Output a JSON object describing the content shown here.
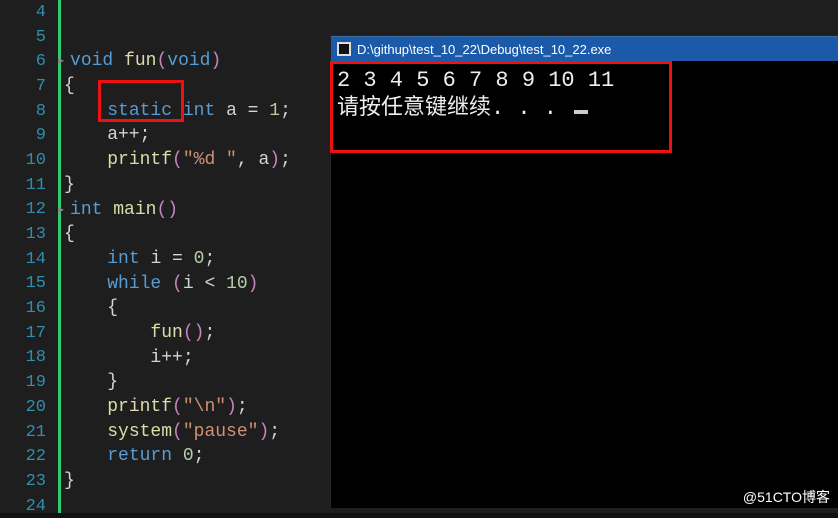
{
  "editor": {
    "first_line": 4,
    "lines": [
      {
        "n": 4,
        "tokens": []
      },
      {
        "n": 5,
        "tokens": []
      },
      {
        "n": 6,
        "tokens": [
          {
            "t": "void ",
            "c": "kw"
          },
          {
            "t": "fun",
            "c": "fn"
          },
          {
            "t": "(",
            "c": "pn"
          },
          {
            "t": "void",
            "c": "kw"
          },
          {
            "t": ")",
            "c": "pn"
          }
        ],
        "fold": true
      },
      {
        "n": 7,
        "tokens": [
          {
            "t": "{",
            "c": "op"
          }
        ]
      },
      {
        "n": 8,
        "tokens": [
          {
            "t": "    ",
            "c": "op"
          },
          {
            "t": "static ",
            "c": "kw"
          },
          {
            "t": "int ",
            "c": "kw"
          },
          {
            "t": "a = ",
            "c": "op"
          },
          {
            "t": "1",
            "c": "num"
          },
          {
            "t": ";",
            "c": "op"
          }
        ]
      },
      {
        "n": 9,
        "tokens": [
          {
            "t": "    a++;",
            "c": "op"
          }
        ]
      },
      {
        "n": 10,
        "tokens": [
          {
            "t": "    ",
            "c": "op"
          },
          {
            "t": "printf",
            "c": "fn"
          },
          {
            "t": "(",
            "c": "pn"
          },
          {
            "t": "\"%d \"",
            "c": "str"
          },
          {
            "t": ", a",
            "c": "op"
          },
          {
            "t": ")",
            "c": "pn"
          },
          {
            "t": ";",
            "c": "op"
          }
        ]
      },
      {
        "n": 11,
        "tokens": [
          {
            "t": "}",
            "c": "op"
          }
        ]
      },
      {
        "n": 12,
        "tokens": [
          {
            "t": "int ",
            "c": "kw"
          },
          {
            "t": "main",
            "c": "fn"
          },
          {
            "t": "(",
            "c": "pn"
          },
          {
            "t": ")",
            "c": "pn"
          }
        ],
        "fold": true
      },
      {
        "n": 13,
        "tokens": [
          {
            "t": "{",
            "c": "op"
          }
        ]
      },
      {
        "n": 14,
        "tokens": [
          {
            "t": "    ",
            "c": "op"
          },
          {
            "t": "int ",
            "c": "kw"
          },
          {
            "t": "i = ",
            "c": "op"
          },
          {
            "t": "0",
            "c": "num"
          },
          {
            "t": ";",
            "c": "op"
          }
        ]
      },
      {
        "n": 15,
        "tokens": [
          {
            "t": "    ",
            "c": "op"
          },
          {
            "t": "while ",
            "c": "kw"
          },
          {
            "t": "(",
            "c": "pn"
          },
          {
            "t": "i < ",
            "c": "op"
          },
          {
            "t": "10",
            "c": "num"
          },
          {
            "t": ")",
            "c": "pn"
          }
        ]
      },
      {
        "n": 16,
        "tokens": [
          {
            "t": "    {",
            "c": "op"
          }
        ]
      },
      {
        "n": 17,
        "tokens": [
          {
            "t": "        ",
            "c": "op"
          },
          {
            "t": "fun",
            "c": "fn"
          },
          {
            "t": "(",
            "c": "pn"
          },
          {
            "t": ")",
            "c": "pn"
          },
          {
            "t": ";",
            "c": "op"
          }
        ]
      },
      {
        "n": 18,
        "tokens": [
          {
            "t": "        i++;",
            "c": "op"
          }
        ]
      },
      {
        "n": 19,
        "tokens": [
          {
            "t": "    }",
            "c": "op"
          }
        ]
      },
      {
        "n": 20,
        "tokens": [
          {
            "t": "    ",
            "c": "op"
          },
          {
            "t": "printf",
            "c": "fn"
          },
          {
            "t": "(",
            "c": "pn"
          },
          {
            "t": "\"\\n\"",
            "c": "str"
          },
          {
            "t": ")",
            "c": "pn"
          },
          {
            "t": ";",
            "c": "op"
          }
        ]
      },
      {
        "n": 21,
        "tokens": [
          {
            "t": "    ",
            "c": "op"
          },
          {
            "t": "system",
            "c": "fn"
          },
          {
            "t": "(",
            "c": "pn"
          },
          {
            "t": "\"pause\"",
            "c": "str"
          },
          {
            "t": ")",
            "c": "pn"
          },
          {
            "t": ";",
            "c": "op"
          }
        ]
      },
      {
        "n": 22,
        "tokens": [
          {
            "t": "    ",
            "c": "op"
          },
          {
            "t": "return ",
            "c": "kw"
          },
          {
            "t": "0",
            "c": "num"
          },
          {
            "t": ";",
            "c": "op"
          }
        ]
      },
      {
        "n": 23,
        "tokens": [
          {
            "t": "}",
            "c": "op"
          }
        ]
      },
      {
        "n": 24,
        "tokens": []
      }
    ]
  },
  "console": {
    "title": "D:\\githup\\test_10_22\\Debug\\test_10_22.exe",
    "output_line1": "2 3 4 5 6 7 8 9 10 11",
    "output_line2": "请按任意键继续. . . "
  },
  "watermark": "@51CTO博客"
}
